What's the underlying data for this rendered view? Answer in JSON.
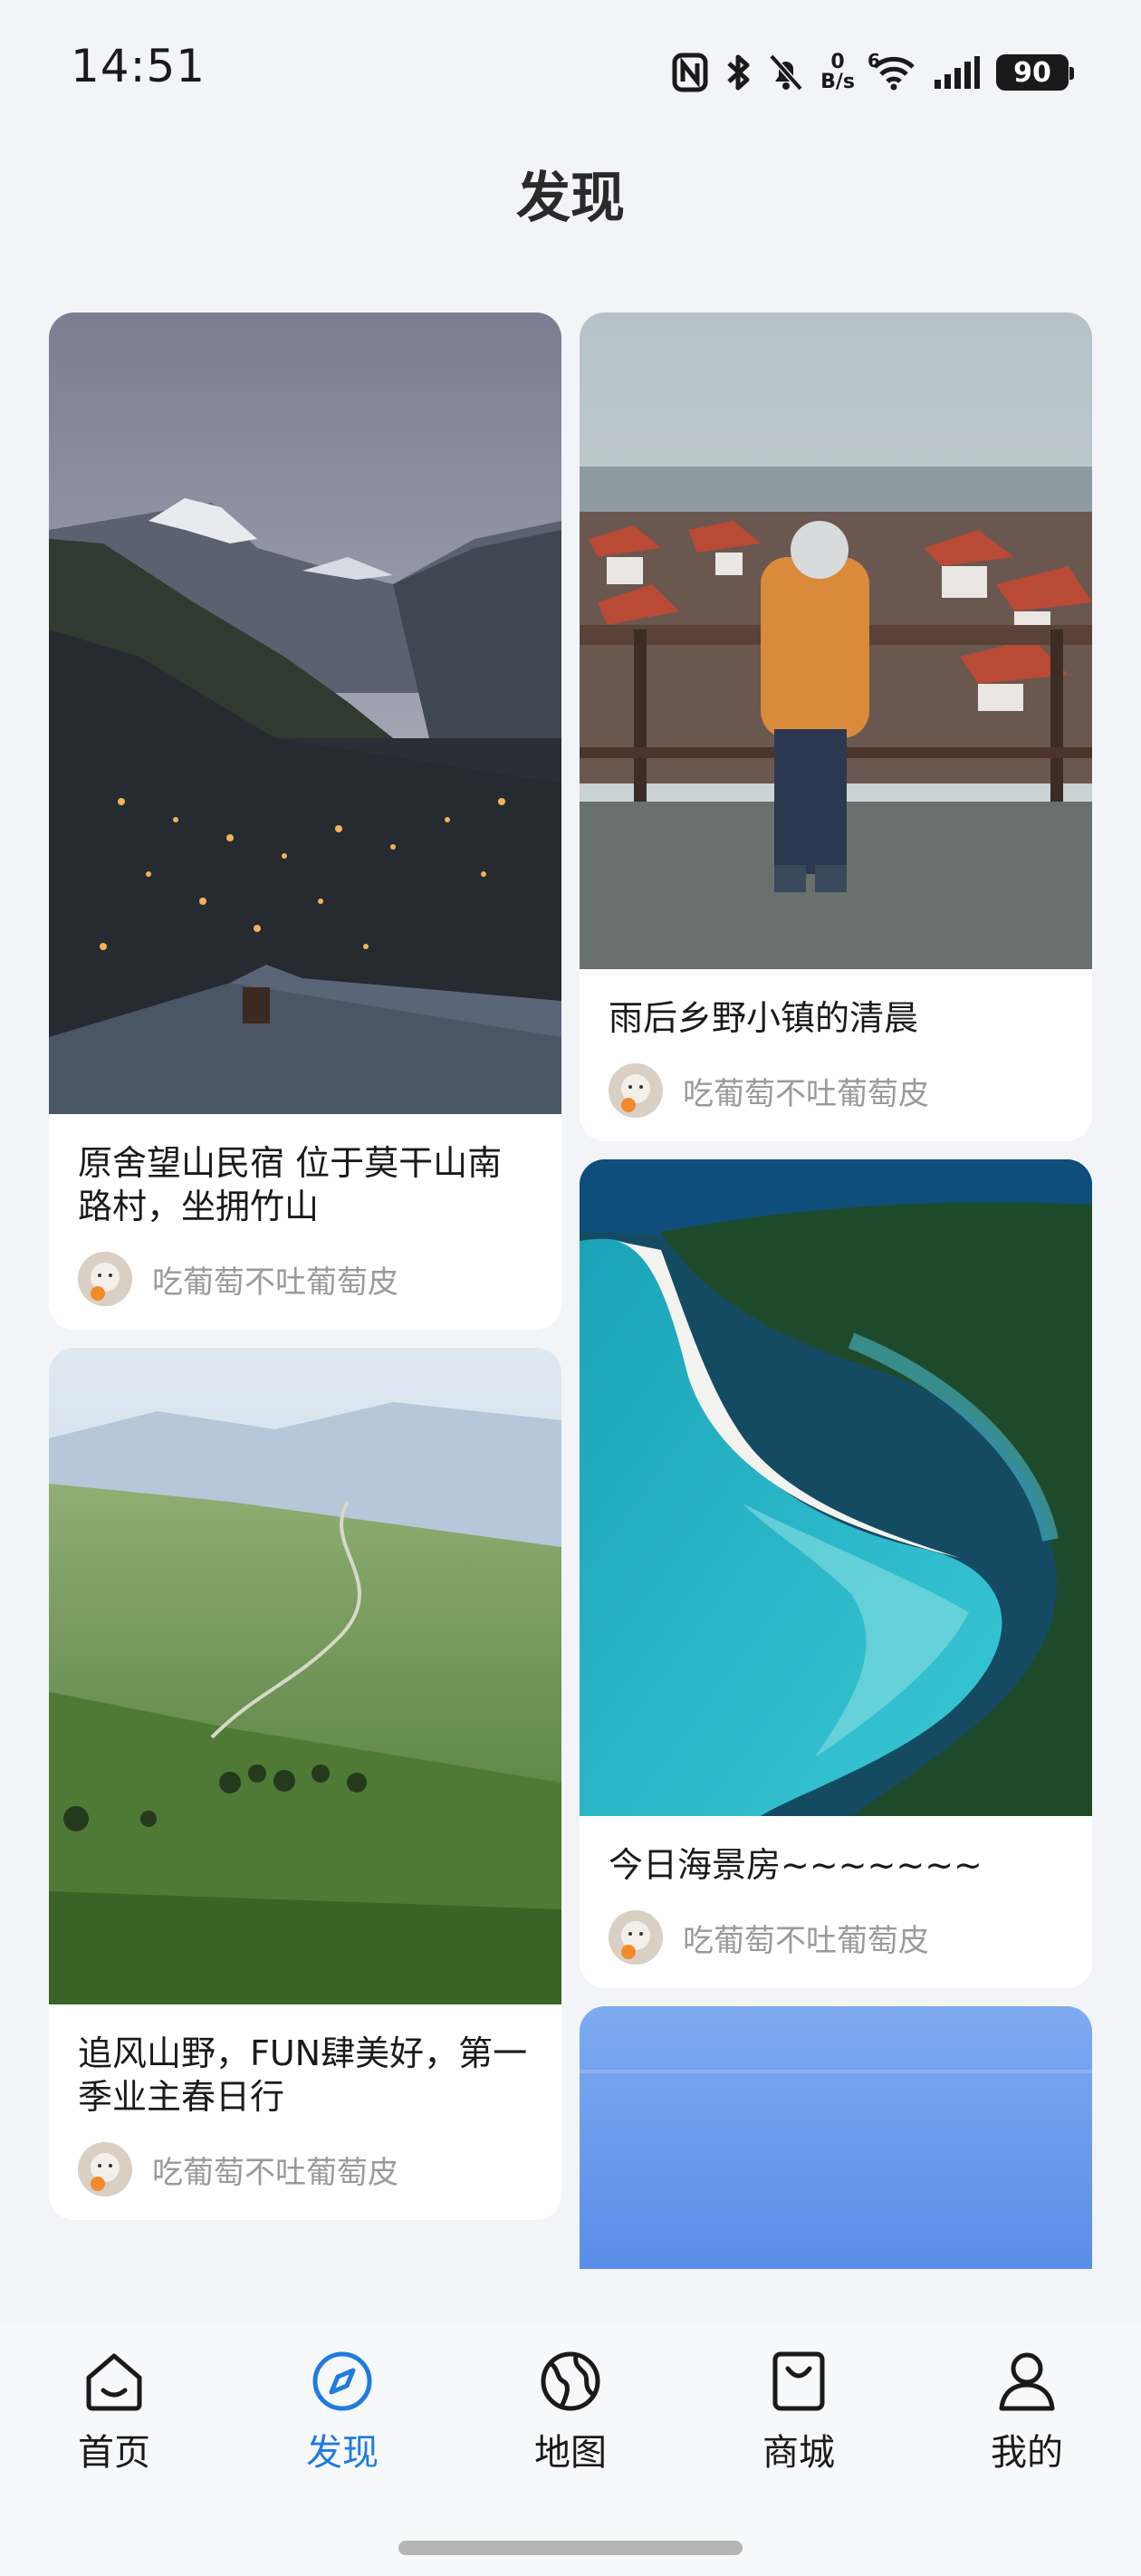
{
  "status_bar": {
    "time": "14:51",
    "net_speed_value": "0",
    "net_speed_unit": "B/s",
    "signal_label": "6",
    "battery": "90"
  },
  "page": {
    "title": "发现"
  },
  "feed": {
    "left": [
      {
        "title": "原舍望山民宿 位于莫干山南路村，坐拥竹山",
        "author": "吃葡萄不吐葡萄皮",
        "image": "mountain-village-night"
      },
      {
        "title": "追风山野，FUN肆美好，第一季业主春日行",
        "author": "吃葡萄不吐葡萄皮",
        "image": "green-hills"
      }
    ],
    "right": [
      {
        "title": "雨后乡野小镇的清晨",
        "author": "吃葡萄不吐葡萄皮",
        "image": "child-on-railing-town"
      },
      {
        "title": "今日海景房~~~~~~~",
        "author": "吃葡萄不吐葡萄皮",
        "image": "aerial-beach-river"
      },
      {
        "title": "",
        "author": "",
        "image": "blue-sky-sea"
      }
    ]
  },
  "tabs": [
    {
      "label": "首页",
      "icon": "home-icon",
      "active": false
    },
    {
      "label": "发现",
      "icon": "compass-icon",
      "active": true
    },
    {
      "label": "地图",
      "icon": "globe-icon",
      "active": false
    },
    {
      "label": "商城",
      "icon": "shopping-bag-icon",
      "active": false
    },
    {
      "label": "我的",
      "icon": "person-icon",
      "active": false
    }
  ],
  "colors": {
    "accent": "#1f7be0",
    "background": "#f3f4f8",
    "muted_text": "#9a9a9a"
  }
}
